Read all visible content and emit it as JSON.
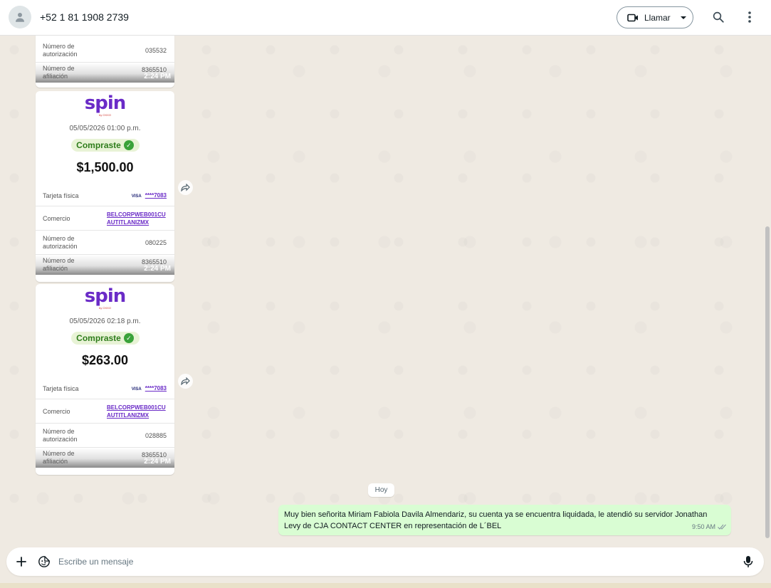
{
  "header": {
    "contact_name": "+52 1 81 1908 2739",
    "call_label": "Llamar"
  },
  "receipts": [
    {
      "partial": true,
      "auth_label": "Número de autorización",
      "auth_value": "035532",
      "affil_label": "Número de afiliación",
      "affil_value": "8365510",
      "time": "2:24 PM"
    },
    {
      "logo": "spin",
      "logo_sub": "by OXXO",
      "date": "05/05/2026 01:00 p.m.",
      "status": "Compraste",
      "amount": "$1,500.00",
      "card_label": "Tarjeta física",
      "card_brand": "VISA",
      "card_value": "****7083",
      "merchant_label": "Comercio",
      "merchant_value": "BELCORPWEB001CU AUTITLANIZMX",
      "auth_label": "Número de autorización",
      "auth_value": "080225",
      "affil_label": "Número de afiliación",
      "affil_value": "8365510",
      "time": "2:24 PM"
    },
    {
      "logo": "spin",
      "logo_sub": "by OXXO",
      "date": "05/05/2026 02:18 p.m.",
      "status": "Compraste",
      "amount": "$263.00",
      "card_label": "Tarjeta física",
      "card_brand": "VISA",
      "card_value": "****7083",
      "merchant_label": "Comercio",
      "merchant_value": "BELCORPWEB001CU AUTITLANIZMX",
      "auth_label": "Número de autorización",
      "auth_value": "028885",
      "affil_label": "Número de afiliación",
      "affil_value": "8365510",
      "time": "2:24 PM"
    }
  ],
  "day_chip": "Hoy",
  "outgoing_message": {
    "text": "Muy bien señorita Miriam Fabiola Davila Almendariz, su cuenta ya se encuentra liquidada, le atendió su servidor Jonathan Levy de CJA CONTACT CENTER en representación de L´BEL",
    "time": "9:50 AM"
  },
  "composer": {
    "placeholder": "Escribe un mensaje"
  },
  "icons": {
    "avatar": "person-icon",
    "call": "video-camera-icon",
    "dropdown": "caret-down-icon",
    "search": "search-icon",
    "menu": "more-vertical-icon",
    "forward": "forward-icon",
    "attach": "plus-icon",
    "sticker": "sticker-icon",
    "mic": "microphone-icon",
    "read": "double-check-icon"
  },
  "colors": {
    "chat_bg": "#efeae2",
    "outgoing_bubble": "#d9fdd3",
    "spin_purple": "#6a2bc7",
    "success_green": "#3aa23a"
  }
}
